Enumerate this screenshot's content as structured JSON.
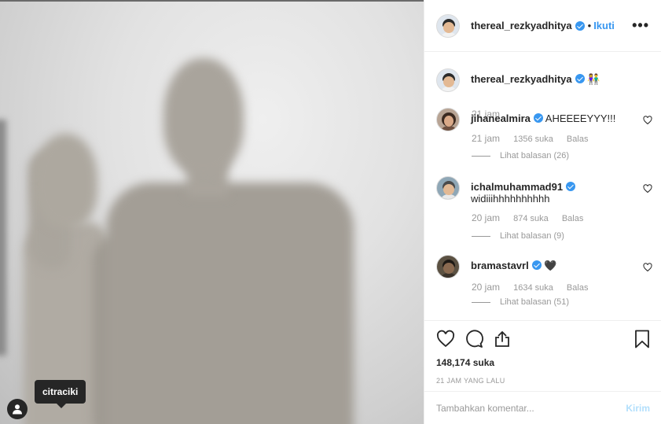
{
  "photo": {
    "tag_username": "citraciki",
    "tag_button_icon": "user-icon"
  },
  "header": {
    "username": "thereal_rezkyadhitya",
    "separator": "•",
    "follow_label": "Ikuti",
    "more_icon": "more-icon",
    "more_label": "•••"
  },
  "caption": {
    "username": "thereal_rezkyadhitya",
    "text": "👫",
    "time": "21 jam"
  },
  "comments": [
    {
      "username": "jihanealmira",
      "text": "AHEEEEYYY!!!",
      "time": "21 jam",
      "likes": "1356 suka",
      "reply_label": "Balas",
      "view_replies": "Lihat balasan (26)"
    },
    {
      "username": "ichalmuhammad91",
      "text": "widiiihhhhhhhhhh",
      "time": "20 jam",
      "likes": "874 suka",
      "reply_label": "Balas",
      "view_replies": "Lihat balasan (9)"
    },
    {
      "username": "bramastavrl",
      "text": "🖤",
      "time": "20 jam",
      "likes": "1634 suka",
      "reply_label": "Balas",
      "view_replies": "Lihat balasan (51)"
    }
  ],
  "actions": {
    "icons": [
      "heart-icon",
      "comment-icon",
      "share-icon",
      "bookmark-icon"
    ],
    "likes_count": "148,174 suka",
    "posted_ago": "21 JAM YANG LALU"
  },
  "add_comment": {
    "placeholder": "Tambahkan komentar...",
    "send_label": "Kirim"
  },
  "colors": {
    "accent": "#3897f0",
    "muted": "#999999",
    "send_disabled": "#b2dffc",
    "text": "#262626"
  }
}
